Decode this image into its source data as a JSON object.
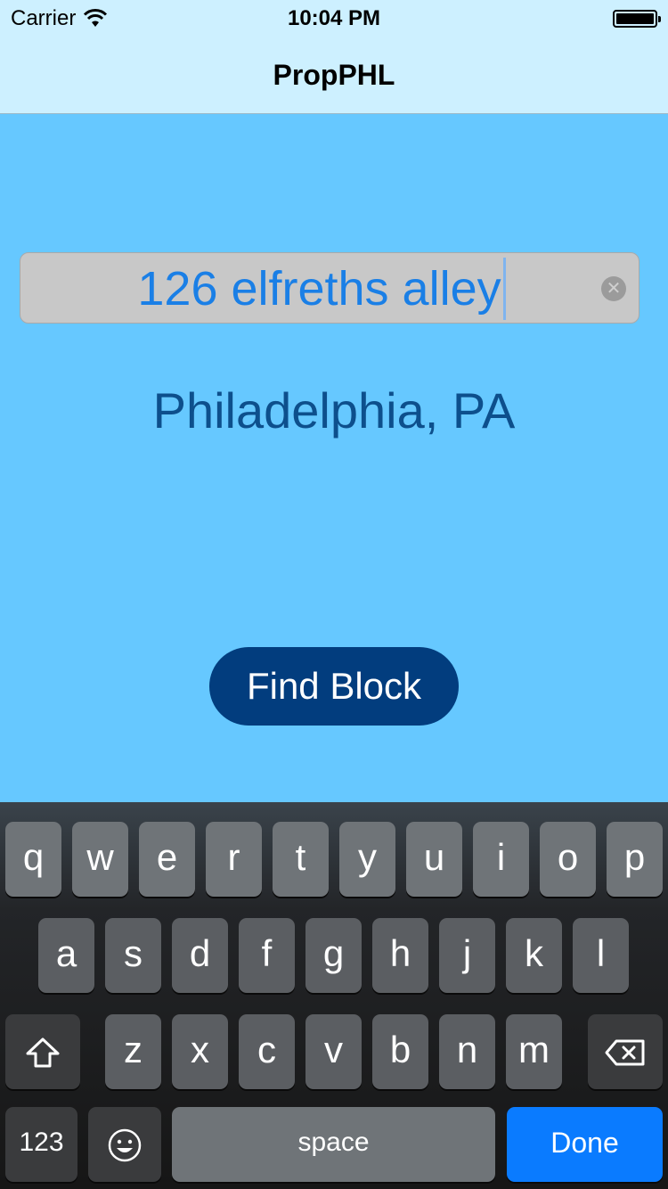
{
  "status_bar": {
    "carrier": "Carrier",
    "time": "10:04 PM"
  },
  "nav": {
    "title": "PropPHL"
  },
  "form": {
    "address_value": "126 elfreths alley",
    "clear_glyph": "✕",
    "city_label": "Philadelphia, PA",
    "find_button": "Find Block"
  },
  "keyboard": {
    "row1": [
      "q",
      "w",
      "e",
      "r",
      "t",
      "y",
      "u",
      "i",
      "o",
      "p"
    ],
    "row2": [
      "a",
      "s",
      "d",
      "f",
      "g",
      "h",
      "j",
      "k",
      "l"
    ],
    "row3": [
      "z",
      "x",
      "c",
      "v",
      "b",
      "n",
      "m"
    ],
    "numbers_key": "123",
    "space_key": "space",
    "done_key": "Done",
    "icons": {
      "shift": "shift-icon",
      "delete": "delete-icon",
      "emoji": "emoji-icon"
    }
  },
  "colors": {
    "background": "#66c8ff",
    "nav": "#cdf0ff",
    "button": "#023d7e",
    "done": "#0a7bff",
    "text_blue": "#1a7fe6"
  }
}
